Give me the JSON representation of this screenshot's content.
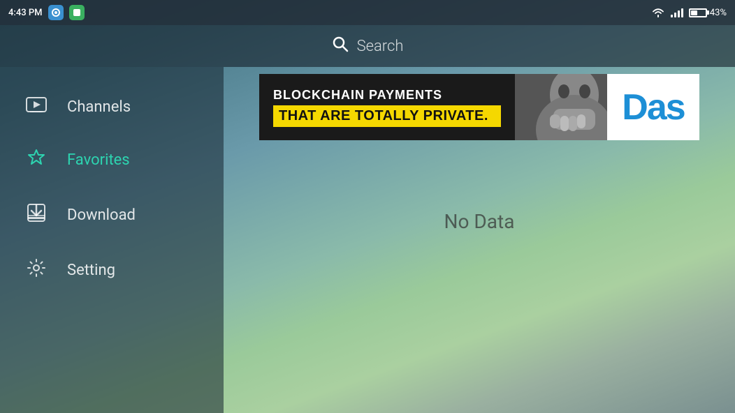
{
  "status_bar": {
    "time": "4:43 PM",
    "battery_percent": "43%",
    "icons": [
      {
        "name": "app1-icon",
        "color": "blue"
      },
      {
        "name": "app2-icon",
        "color": "green"
      }
    ]
  },
  "search": {
    "placeholder": "Search"
  },
  "sidebar": {
    "items": [
      {
        "id": "channels",
        "label": "Channels",
        "active": false
      },
      {
        "id": "favorites",
        "label": "Favorites",
        "active": true
      },
      {
        "id": "download",
        "label": "Download",
        "active": false
      },
      {
        "id": "setting",
        "label": "Setting",
        "active": false
      }
    ]
  },
  "ad": {
    "top_text": "BLOCKCHAIN PAYMENTS",
    "bottom_text": "THAT ARE TOTALLY PRIVATE.",
    "logo": "Das"
  },
  "main": {
    "no_data_text": "No Data"
  }
}
